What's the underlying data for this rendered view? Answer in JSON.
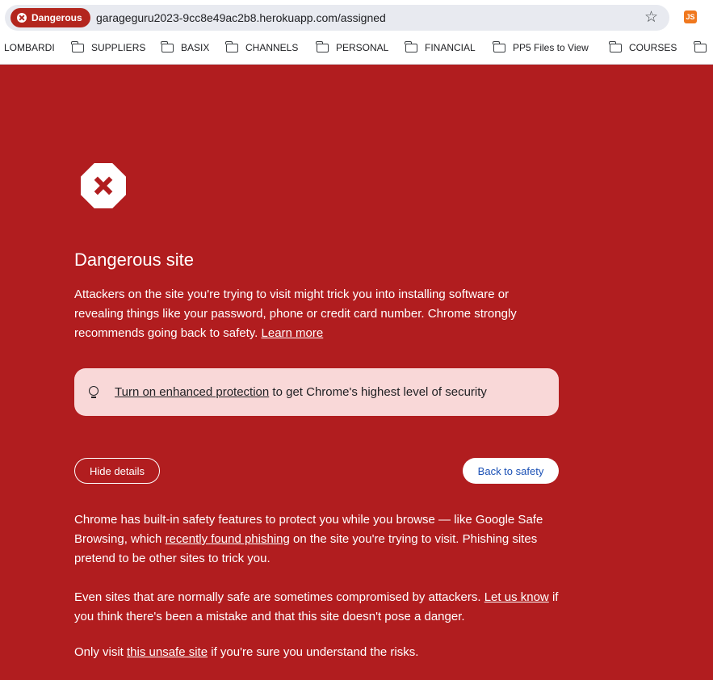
{
  "browser": {
    "security_chip": "Dangerous",
    "url": "garageguru2023-9cc8e49ac2b8.herokuapp.com/assigned",
    "extension_label": "JS"
  },
  "bookmarks": {
    "items": [
      {
        "label": "LOMBARDI",
        "folder": false
      },
      {
        "label": "SUPPLIERS",
        "folder": true
      },
      {
        "label": "BASIX",
        "folder": true
      },
      {
        "label": "CHANNELS",
        "folder": true
      },
      {
        "label": "PERSONAL",
        "folder": true
      },
      {
        "label": "FINANCIAL",
        "folder": true
      },
      {
        "label": "PP5 Files to View",
        "folder": true
      },
      {
        "label": "COURSES",
        "folder": true
      }
    ]
  },
  "interstitial": {
    "title": "Dangerous site",
    "intro_text": "Attackers on the site you're trying to visit might trick you into installing software or revealing things like your password, phone or credit card number. Chrome strongly recommends going back to safety.",
    "learn_more": "Learn more",
    "tip_link": "Turn on enhanced protection",
    "tip_text": "to get Chrome's highest level of security",
    "hide_details_button": "Hide details",
    "back_to_safety_button": "Back to safety",
    "details_1_a": "Chrome has built-in safety features to protect you while you browse — like Google Safe Browsing, which",
    "details_1_link": "recently found phishing",
    "details_1_b": "on the site you're trying to visit. Phishing sites pretend to be other sites to trick you.",
    "details_2_a": "Even sites that are normally safe are sometimes compromised by attackers.",
    "details_2_link": "Let us know",
    "details_2_b": "if you think there's been a mistake and that this site doesn't pose a danger.",
    "details_3_a": "Only visit",
    "details_3_link": "this unsafe site",
    "details_3_b": "if you're sure you understand the risks."
  },
  "colors": {
    "page_background": "#b11d1f",
    "danger_chip": "#b3261e",
    "tip_background": "#f9d8d8",
    "back_button_text": "#1a50b5"
  },
  "icons": [
    "danger-x-icon",
    "star-icon",
    "extension-js-icon",
    "folder-icon",
    "stop-sign-icon",
    "lightbulb-icon"
  ]
}
